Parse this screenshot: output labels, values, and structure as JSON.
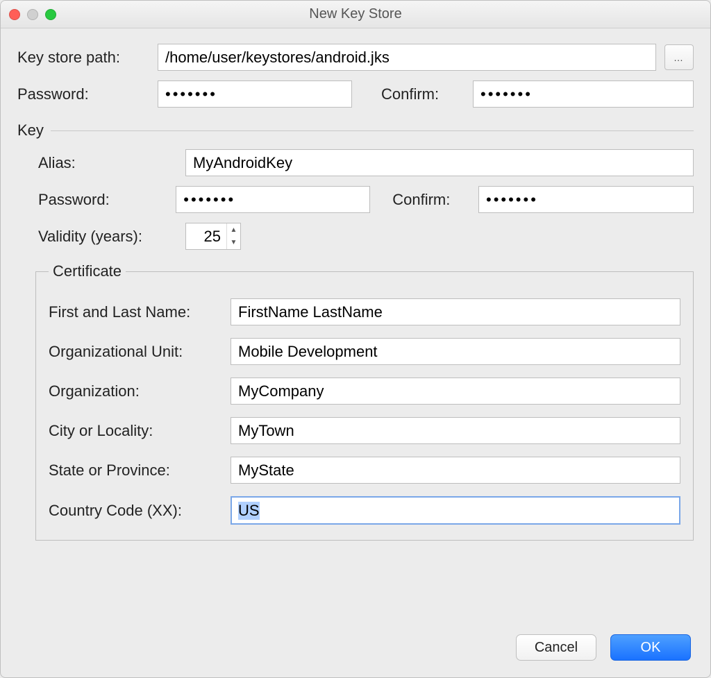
{
  "window": {
    "title": "New Key Store"
  },
  "keystore": {
    "path_label": "Key store path:",
    "path_value": "/home/user/keystores/android.jks",
    "browse_glyph": "…",
    "password_label": "Password:",
    "password_value": "•••••••",
    "confirm_label": "Confirm:",
    "confirm_value": "•••••••"
  },
  "key": {
    "section_label": "Key",
    "alias_label": "Alias:",
    "alias_value": "MyAndroidKey",
    "password_label": "Password:",
    "password_value": "•••••••",
    "confirm_label": "Confirm:",
    "confirm_value": "•••••••",
    "validity_label": "Validity (years):",
    "validity_value": "25"
  },
  "certificate": {
    "legend": "Certificate",
    "first_last_label": "First and Last Name:",
    "first_last_value": "FirstName LastName",
    "ou_label": "Organizational Unit:",
    "ou_value": "Mobile Development",
    "org_label": "Organization:",
    "org_value": "MyCompany",
    "city_label": "City or Locality:",
    "city_value": "MyTown",
    "state_label": "State or Province:",
    "state_value": "MyState",
    "country_label": "Country Code (XX):",
    "country_value": "US"
  },
  "footer": {
    "cancel_label": "Cancel",
    "ok_label": "OK"
  }
}
